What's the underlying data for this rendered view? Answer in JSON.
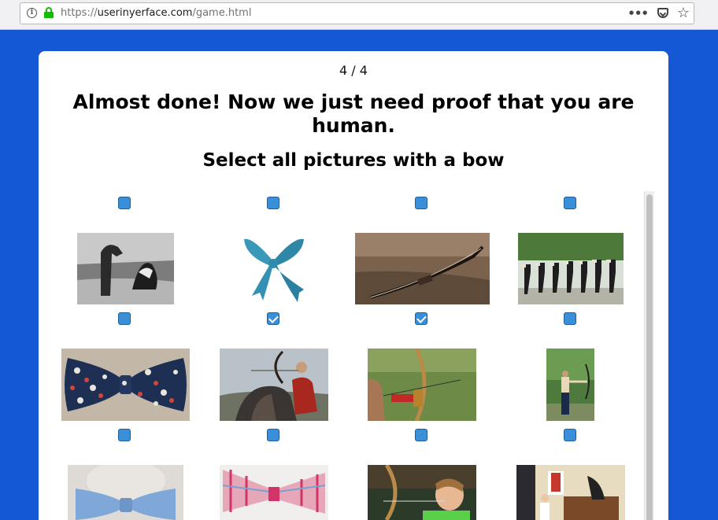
{
  "browser": {
    "url_prefix": "https://",
    "url_host": "userinyerface.com",
    "url_path": "/game.html",
    "more_glyph": "•••",
    "star_glyph": "☆"
  },
  "page": {
    "step": "4 / 4",
    "title": "Almost done! Now we just need proof that you are human.",
    "subtitle": "Select all pictures with a bow"
  },
  "grid": {
    "header_checkboxes": [
      false,
      false,
      false,
      false
    ],
    "images": [
      {
        "icon": "seal-icebergs-photo",
        "checked": false
      },
      {
        "icon": "blue-ribbon-bow-photo",
        "checked": true
      },
      {
        "icon": "longbow-on-ground-photo",
        "checked": true
      },
      {
        "icon": "people-bowing-photo",
        "checked": false
      },
      {
        "icon": "floral-bow-tie-photo",
        "checked": false
      },
      {
        "icon": "mounted-archer-photo",
        "checked": false
      },
      {
        "icon": "archer-drawing-bow-photo",
        "checked": false
      },
      {
        "icon": "archer-girl-photo",
        "checked": false
      },
      {
        "icon": "blue-bow-tie-teddy-photo",
        "checked": false
      },
      {
        "icon": "plaid-bow-tie-photo",
        "checked": false
      },
      {
        "icon": "boy-archer-photo",
        "checked": false
      },
      {
        "icon": "office-meeting-photo",
        "checked": false
      }
    ]
  },
  "colors": {
    "background": "#1558d6",
    "checkbox": "#3a8fd9"
  }
}
